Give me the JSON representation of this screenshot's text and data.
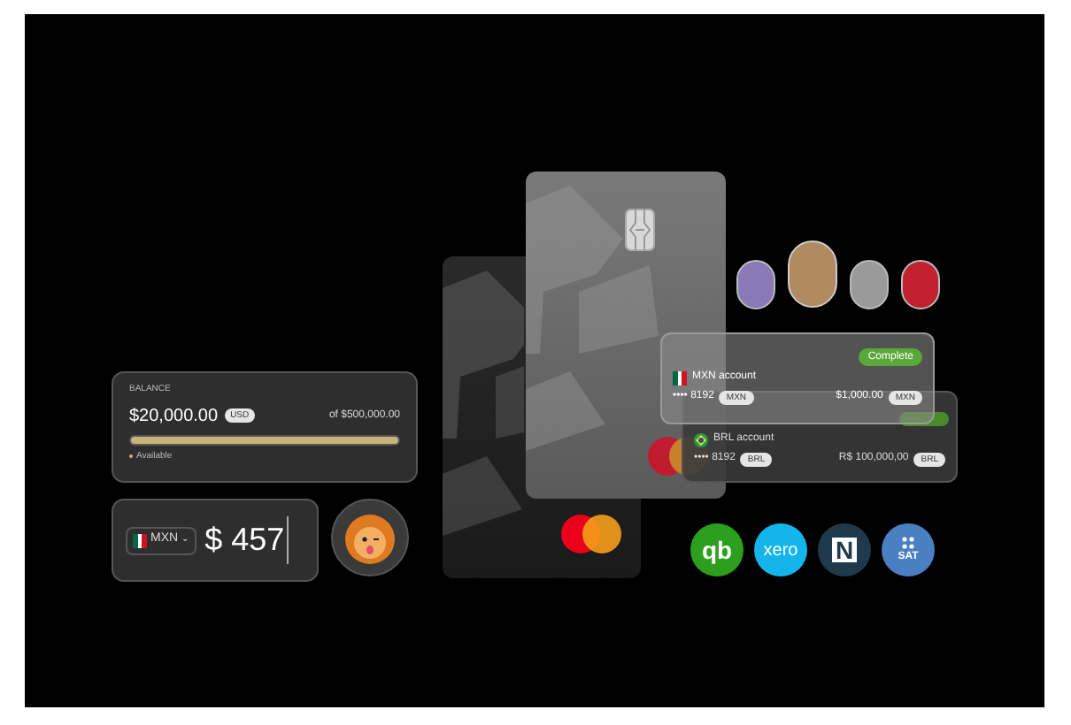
{
  "balance_card": {
    "label": "BALANCE",
    "amount": "$20,000.00",
    "currency": "USD",
    "limit": "of $500,000.00",
    "level": 1,
    "legend": "Available"
  },
  "amount_input": {
    "currency": "MXN",
    "caret": "⌄",
    "symbol": "$",
    "value": "457"
  },
  "accounts": [
    {
      "name": "MXN account",
      "number": "•••• 8192",
      "currency_tag": "MXN",
      "amount": "$1,000.00",
      "amount_tag": "MXN",
      "badge": "Complete",
      "kind": "mexico"
    },
    {
      "name": "BRL account",
      "number": "•••• 8192",
      "currency_tag": "BRL",
      "amount": "R$ 100,000,00",
      "amount_tag": "BRL",
      "kind": "brazil"
    }
  ],
  "integrations": [
    {
      "kind": "quickbooks",
      "label": "qb",
      "color": "#2ca01c"
    },
    {
      "kind": "xero",
      "label": "xero",
      "color": "#13b5ea"
    },
    {
      "kind": "netsuite",
      "label": "N",
      "color": "#1f3a4d"
    },
    {
      "kind": "sat",
      "label": "SAT",
      "color": "#4a7fc1"
    }
  ]
}
